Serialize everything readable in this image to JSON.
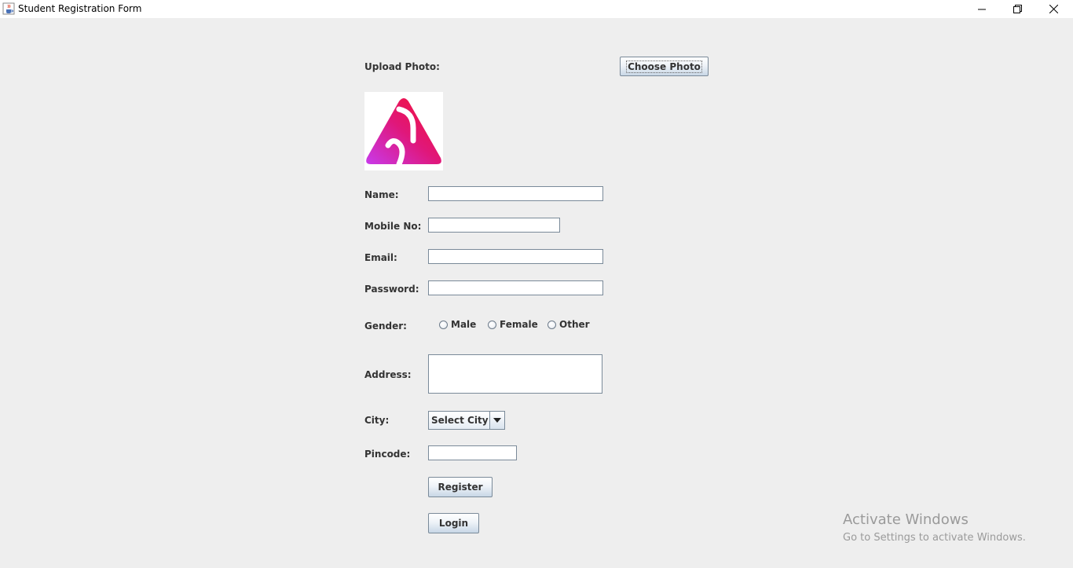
{
  "window": {
    "title": "Student Registration Form",
    "icon": "java-cup-icon"
  },
  "form": {
    "upload_label": "Upload Photo:",
    "choose_photo_button": "Choose Photo",
    "photo": {
      "icon": "gradient-triangle-logo"
    },
    "name": {
      "label": "Name:",
      "value": ""
    },
    "mobile": {
      "label": "Mobile No:",
      "value": ""
    },
    "email": {
      "label": "Email:",
      "value": ""
    },
    "password": {
      "label": "Password:",
      "value": ""
    },
    "gender": {
      "label": "Gender:",
      "options": [
        "Male",
        "Female",
        "Other"
      ],
      "selected": null
    },
    "address": {
      "label": "Address:",
      "value": ""
    },
    "city": {
      "label": "City:",
      "selected": "Select City"
    },
    "pincode": {
      "label": "Pincode:",
      "value": ""
    },
    "register_button": "Register",
    "login_button": "Login"
  },
  "watermark": {
    "line1": "Activate Windows",
    "line2": "Go to Settings to activate Windows."
  },
  "colors": {
    "background": "#eeeeee",
    "button_gradient_bottom": "#c8d7e6",
    "logo_pink": "#e0177a",
    "logo_red": "#f5122f",
    "logo_purple": "#c83aeb"
  }
}
